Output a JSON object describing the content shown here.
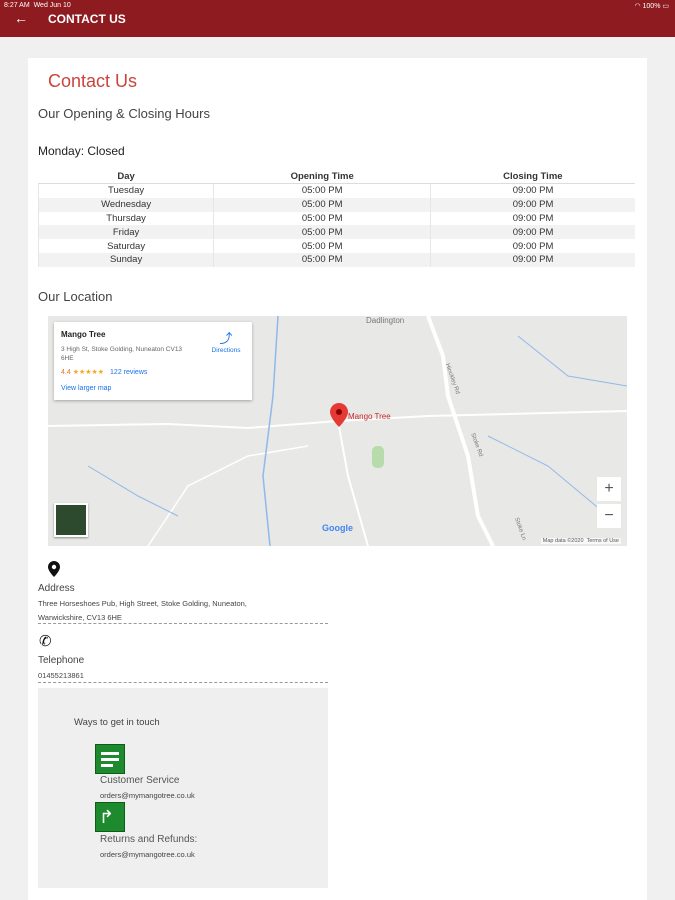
{
  "status": {
    "time": "8:27 AM",
    "date": "Wed Jun 10",
    "battery": "100%"
  },
  "header": {
    "title": "CONTACT US"
  },
  "page": {
    "heading": "Contact Us",
    "hours_heading": "Our Opening & Closing Hours",
    "closed_note": "Monday: Closed",
    "table": {
      "columns": [
        "Day",
        "Opening Time",
        "Closing Time"
      ],
      "rows": [
        [
          "Tuesday",
          "05:00 PM",
          "09:00 PM"
        ],
        [
          "Wednesday",
          "05:00 PM",
          "09:00 PM"
        ],
        [
          "Thursday",
          "05:00 PM",
          "09:00 PM"
        ],
        [
          "Friday",
          "05:00 PM",
          "09:00 PM"
        ],
        [
          "Saturday",
          "05:00 PM",
          "09:00 PM"
        ],
        [
          "Sunday",
          "05:00 PM",
          "09:00 PM"
        ]
      ]
    },
    "location_heading": "Our Location"
  },
  "map": {
    "place_name": "Mango Tree",
    "place_address": "3 High St, Stoke Golding, Nuneaton CV13 6HE",
    "rating": "4.4",
    "stars": "★★★★★",
    "reviews": "122 reviews",
    "directions": "Directions",
    "view_larger": "View larger map",
    "pin_label": "Mango Tree",
    "town_label": "Dadlington",
    "google": "Google",
    "attribution": "Map data ©2020",
    "terms": "Terms of Use",
    "road1": "Hinckley Rd",
    "road2": "Stoke Rd",
    "road3": "Stoke Ln"
  },
  "contact": {
    "address_label": "Address",
    "address_line1": "Three Horseshoes Pub, High Street, Stoke Golding, Nuneaton,",
    "address_line2": "Warwickshire, CV13 6HE",
    "telephone_label": "Telephone",
    "telephone": "01455213861"
  },
  "ways": {
    "heading": "Ways to get in touch",
    "service_label": "Customer Service",
    "service_email": "orders@mymangotree.co.uk",
    "refunds_label": "Returns and Refunds:",
    "refunds_email": "orders@mymangotree.co.uk"
  }
}
